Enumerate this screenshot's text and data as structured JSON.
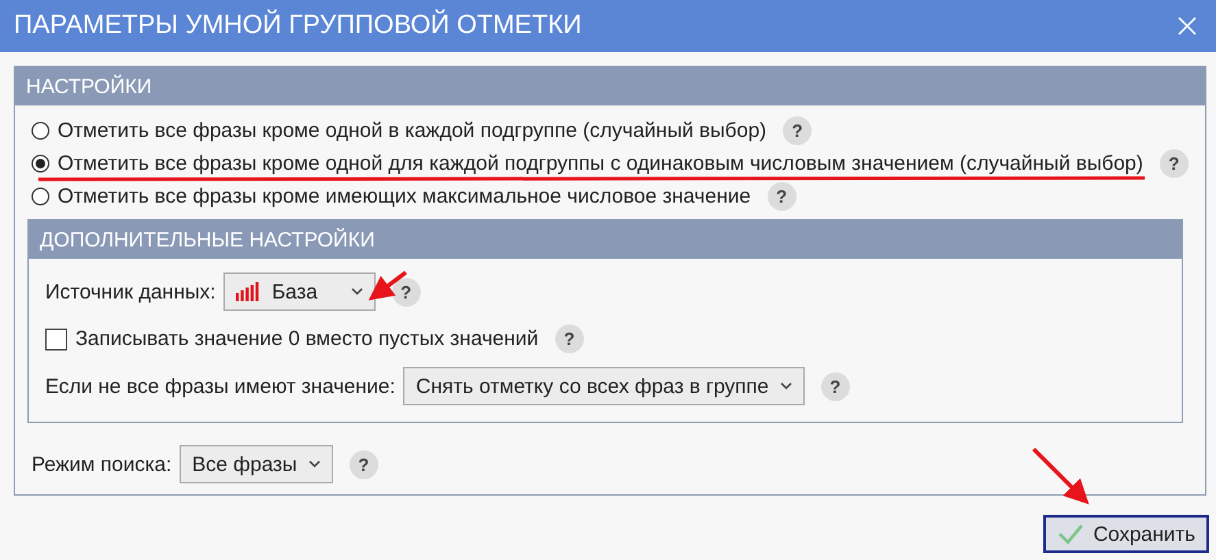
{
  "window": {
    "title": "ПАРАМЕТРЫ УМНОЙ ГРУППОВОЙ ОТМЕТКИ"
  },
  "settings": {
    "title": "НАСТРОЙКИ",
    "options": [
      {
        "label": "Отметить все фразы кроме одной в каждой подгруппе (случайный выбор)",
        "selected": false,
        "help": "?"
      },
      {
        "label": "Отметить все фразы кроме одной для каждой подгруппы с одинаковым числовым значением (случайный выбор)",
        "selected": true,
        "help": "?"
      },
      {
        "label": "Отметить все фразы кроме имеющих максимальное числовое значение",
        "selected": false,
        "help": "?"
      }
    ]
  },
  "additional": {
    "title": "ДОПОЛНИТЕЛЬНЫЕ НАСТРОЙКИ",
    "data_source": {
      "label": "Источник данных:",
      "value": "База",
      "help": "?"
    },
    "write_zero": {
      "label": "Записывать значение 0 вместо пустых значений",
      "checked": false,
      "help": "?"
    },
    "if_not_all": {
      "label": "Если не все фразы имеют значение:",
      "value": "Снять отметку со всех фраз в группе",
      "help": "?"
    }
  },
  "search_mode": {
    "label": "Режим поиска:",
    "value": "Все фразы",
    "help": "?"
  },
  "buttons": [
    {
      "label": "Сохранить"
    }
  ]
}
